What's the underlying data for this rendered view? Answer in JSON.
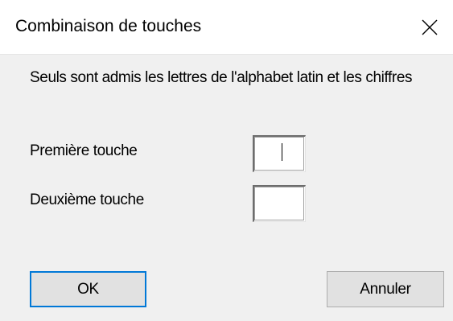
{
  "window": {
    "title": "Combinaison de touches",
    "close_icon": "close-icon"
  },
  "dialog": {
    "info": "Seuls sont admis les lettres de l'alphabet latin et les chiffres",
    "first_key": {
      "label": "Première touche",
      "value": ""
    },
    "second_key": {
      "label": "Deuxième touche",
      "value": ""
    }
  },
  "buttons": {
    "ok": "OK",
    "cancel": "Annuler"
  },
  "colors": {
    "focus_border": "#0078d7",
    "dialog_bg": "#f0f0f0",
    "titlebar_bg": "#ffffff"
  }
}
